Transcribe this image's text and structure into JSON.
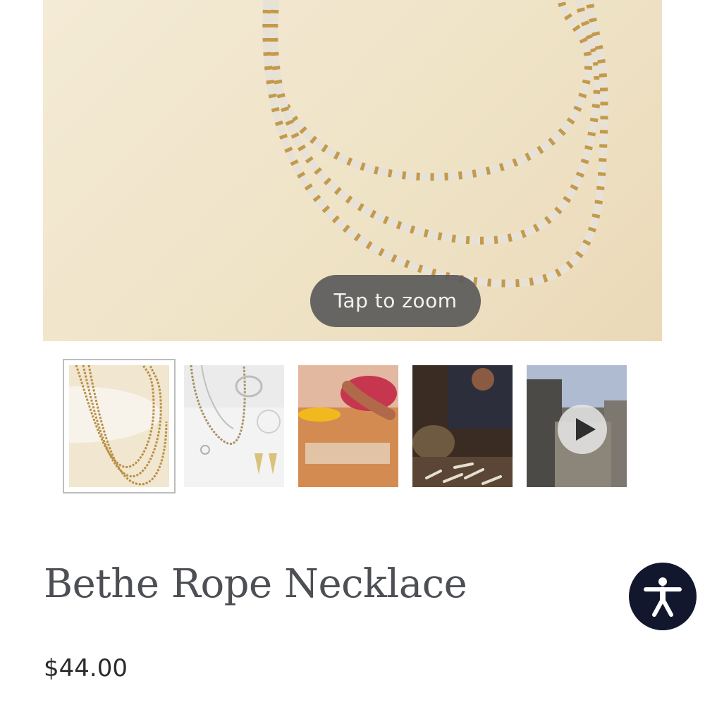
{
  "product": {
    "title": "Bethe Rope Necklace",
    "price": "$44.00"
  },
  "gallery": {
    "zoom_hint": "Tap to zoom",
    "main_image_icon": "necklace-photo",
    "thumbnails": [
      {
        "subject": "necklace-on-wall",
        "selected": true
      },
      {
        "subject": "jewelry-collection",
        "selected": false
      },
      {
        "subject": "artisan-hands-working",
        "selected": false
      },
      {
        "subject": "artisan-at-workbench",
        "selected": false
      },
      {
        "subject": "video-street-scene",
        "selected": false,
        "has_play_icon": true
      }
    ]
  },
  "accessibility": {
    "icon": "accessibility-person-icon"
  },
  "colors": {
    "title": "#4d4f55",
    "price": "#2b2b2b",
    "accessibility_button": "#12172e",
    "zoom_pill": "#5a5a5a"
  }
}
